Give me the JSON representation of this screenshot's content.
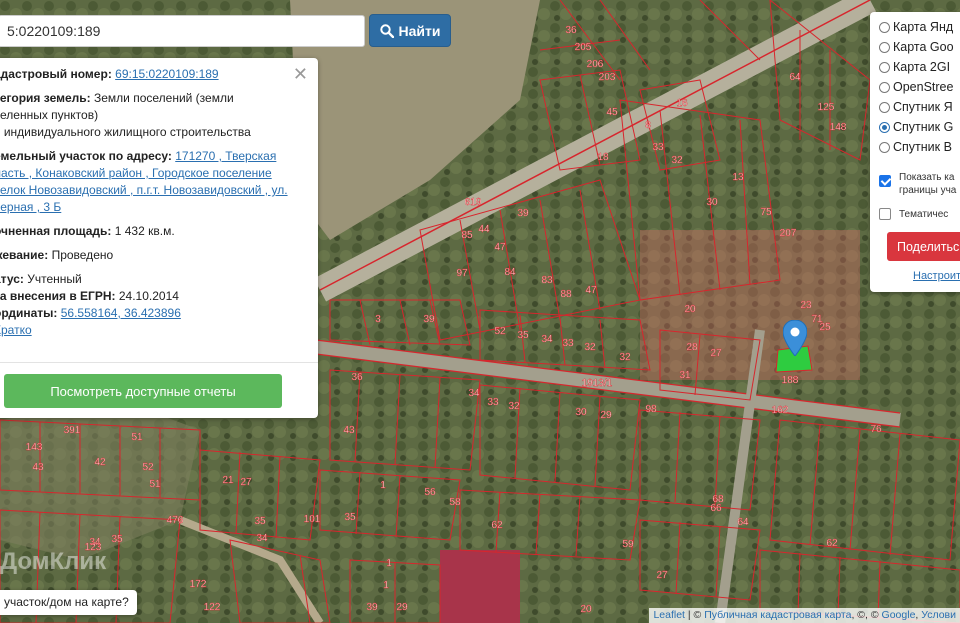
{
  "search": {
    "value": "5:0220109:189",
    "button_label": "Найти"
  },
  "info_panel": {
    "cadastral_number_label": "адастровый номер:",
    "cadastral_number_value": "69:15:0220109:189",
    "land_category_label": "тегория земель:",
    "land_category_value": "Земли поселений (земли",
    "land_category_value_2": "селенных пунктов)",
    "land_category_value_3": "я индивидуального жилищного строительства",
    "address_label": "емельный участок по адресу:",
    "address_line_1": "171270 , Тверская",
    "address_line_2": "ласть , Конаковский район , Городское поселение",
    "address_line_3": "селок Новозавидовский , п.г.т. Новозавидовский , ул.",
    "address_line_4": "верная , 3 Б",
    "area_label": "очненная площадь:",
    "area_value": "1 432 кв.м.",
    "survey_label": "жевание:",
    "survey_value": "Проведено",
    "status_label": "атус:",
    "status_value": "Учтенный",
    "egrn_label": "та внесения в ЕГРН:",
    "egrn_value": "24.10.2014",
    "coords_label": "ординаты:",
    "coords_value": "56.558164, 36.423896",
    "brief_link": "Кратко",
    "report_button": "Посмотреть доступные отчеты"
  },
  "layers_panel": {
    "options": [
      {
        "label": "Карта Янд",
        "selected": false
      },
      {
        "label": "Карта Goo",
        "selected": false
      },
      {
        "label": "Карта 2GI",
        "selected": false
      },
      {
        "label": "OpenStree",
        "selected": false
      },
      {
        "label": "Спутник Я",
        "selected": false
      },
      {
        "label": "Спутник G",
        "selected": true
      },
      {
        "label": "Спутник B",
        "selected": false
      }
    ],
    "show_boundaries_line1": "Показать ка",
    "show_boundaries_line2": "границы уча",
    "thematic": "Тематичес",
    "share_button": "Поделитьс",
    "configure_link": "Настроит"
  },
  "map_labels": {
    "parcels": [
      "36",
      "205",
      "206",
      "203",
      "64",
      "125",
      "148",
      "45",
      "16",
      "8",
      "33",
      "32",
      "18",
      "13",
      "30",
      "75",
      "207",
      "619",
      "39",
      "85",
      "44",
      "47",
      "97",
      "84",
      "83",
      "88",
      "47",
      "20",
      "3",
      "39",
      "52",
      "35",
      "34",
      "33",
      "32",
      "28",
      "27",
      "23",
      "71",
      "25",
      "188",
      "162",
      "36",
      "1913/1",
      "34",
      "33",
      "32",
      "30",
      "29",
      "98",
      "76",
      "391",
      "51",
      "143",
      "43",
      "42",
      "43",
      "52",
      "51",
      "43",
      "21",
      "27",
      "35",
      "101",
      "1",
      "56",
      "58",
      "62",
      "39",
      "35",
      "37",
      "46",
      "68",
      "66",
      "64",
      "62",
      "34",
      "35",
      "123",
      "476",
      "32",
      "172",
      "122",
      "59",
      "27",
      "39",
      "29",
      "1",
      "1",
      "20"
    ],
    "road": "1913/1"
  },
  "attribution": {
    "leaflet": "Leaflet",
    "cadastral_map": "Публичная кадастровая карта",
    "rest": ", ©, ©",
    "google": "Google",
    "terms": "Услови"
  },
  "question_box": "участок/дом на карте?",
  "watermark": "ДомКлик",
  "colors": {
    "primary": "#2e6da4",
    "report": "#5cb85c",
    "share": "#d9363e",
    "parcel_line": "#d7262d",
    "highlight": "#2ecc40"
  }
}
